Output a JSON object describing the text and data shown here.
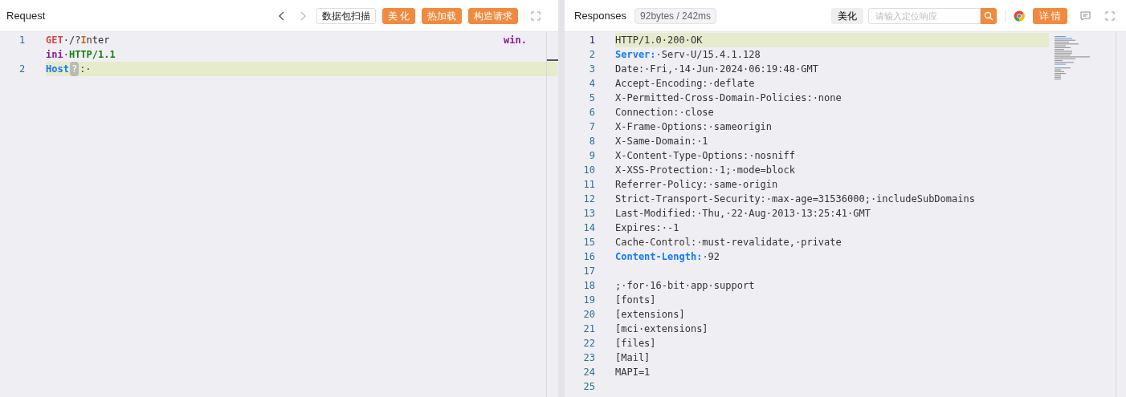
{
  "request": {
    "title": "Request",
    "actions": [
      {
        "label": "数据包扫描",
        "kind": "outline"
      },
      {
        "label": "美 化",
        "kind": "primary"
      },
      {
        "label": "热加载",
        "kind": "primary"
      },
      {
        "label": "构造请求",
        "kind": "primary"
      }
    ],
    "lines": [
      {
        "number": "1",
        "highlighted": false,
        "rows": [
          {
            "tokens": [
              {
                "text": "GET",
                "kind": "method"
              },
              {
                "text": "·/?",
                "kind": "plain"
              },
              {
                "text": "I",
                "kind": "param"
              },
              {
                "text": "nter",
                "kind": "plain"
              }
            ],
            "trailing": [
              {
                "text": "win.",
                "kind": "keyword"
              }
            ]
          },
          {
            "tokens": [
              {
                "text": "ini",
                "kind": "keyword"
              },
              {
                "text": "·",
                "kind": "plain"
              },
              {
                "text": "HTTP/1.1",
                "kind": "version"
              }
            ]
          }
        ]
      },
      {
        "number": "2",
        "highlighted": true,
        "rows": [
          {
            "tokens": [
              {
                "text": "Host",
                "kind": "header-key"
              },
              {
                "text": "?",
                "kind": "hint"
              },
              {
                "text": ":·",
                "kind": "plain"
              }
            ]
          }
        ]
      }
    ]
  },
  "response": {
    "title": "Responses",
    "stats": "92bytes / 242ms",
    "beautify": "美化",
    "search": {
      "placeholder": "请输入定位响应"
    },
    "details": "详 情",
    "lines": [
      {
        "number": "1",
        "highlighted": true,
        "tokens": [
          {
            "text": "HTTP/1.0·200·OK",
            "kind": "plain"
          }
        ]
      },
      {
        "number": "2",
        "highlighted": false,
        "tokens": [
          {
            "text": "Server:",
            "kind": "header-key"
          },
          {
            "text": "·Serv-U/15.4.1.128",
            "kind": "plain"
          }
        ]
      },
      {
        "number": "3",
        "highlighted": false,
        "tokens": [
          {
            "text": "Date:·Fri,·14·Jun·2024·06:19:48·GMT",
            "kind": "plain"
          }
        ]
      },
      {
        "number": "4",
        "highlighted": false,
        "tokens": [
          {
            "text": "Accept-Encoding:·deflate",
            "kind": "plain"
          }
        ]
      },
      {
        "number": "5",
        "highlighted": false,
        "tokens": [
          {
            "text": "X-Permitted-Cross-Domain-Policies:·none",
            "kind": "plain"
          }
        ]
      },
      {
        "number": "6",
        "highlighted": false,
        "tokens": [
          {
            "text": "Connection:·close",
            "kind": "plain"
          }
        ]
      },
      {
        "number": "7",
        "highlighted": false,
        "tokens": [
          {
            "text": "X-Frame-Options:·sameorigin",
            "kind": "plain"
          }
        ]
      },
      {
        "number": "8",
        "highlighted": false,
        "tokens": [
          {
            "text": "X-Same-Domain:·1",
            "kind": "plain"
          }
        ]
      },
      {
        "number": "9",
        "highlighted": false,
        "tokens": [
          {
            "text": "X-Content-Type-Options:·nosniff",
            "kind": "plain"
          }
        ]
      },
      {
        "number": "10",
        "highlighted": false,
        "tokens": [
          {
            "text": "X-XSS-Protection:·1;·mode=block",
            "kind": "plain"
          }
        ]
      },
      {
        "number": "11",
        "highlighted": false,
        "tokens": [
          {
            "text": "Referrer-Policy:·same-origin",
            "kind": "plain"
          }
        ]
      },
      {
        "number": "12",
        "highlighted": false,
        "tokens": [
          {
            "text": "Strict-Transport-Security:·max-age=31536000;·includeSubDomains",
            "kind": "plain"
          }
        ]
      },
      {
        "number": "13",
        "highlighted": false,
        "tokens": [
          {
            "text": "Last-Modified:·Thu,·22·Aug·2013·13:25:41·GMT",
            "kind": "plain"
          }
        ]
      },
      {
        "number": "14",
        "highlighted": false,
        "tokens": [
          {
            "text": "Expires:·-1",
            "kind": "plain"
          }
        ]
      },
      {
        "number": "15",
        "highlighted": false,
        "tokens": [
          {
            "text": "Cache-Control:·must-revalidate,·private",
            "kind": "plain"
          }
        ]
      },
      {
        "number": "16",
        "highlighted": false,
        "tokens": [
          {
            "text": "Content-Length:",
            "kind": "header-key"
          },
          {
            "text": "·92",
            "kind": "plain"
          }
        ]
      },
      {
        "number": "17",
        "highlighted": false
      },
      {
        "number": "18",
        "highlighted": false,
        "tokens": [
          {
            "text": ";·for·16-bit·app·support",
            "kind": "plain"
          }
        ]
      },
      {
        "number": "19",
        "highlighted": false,
        "tokens": [
          {
            "text": "[fonts]",
            "kind": "plain"
          }
        ]
      },
      {
        "number": "20",
        "highlighted": false,
        "tokens": [
          {
            "text": "[extensions]",
            "kind": "plain"
          }
        ]
      },
      {
        "number": "21",
        "highlighted": false,
        "tokens": [
          {
            "text": "[mci·extensions]",
            "kind": "plain"
          }
        ]
      },
      {
        "number": "22",
        "highlighted": false,
        "tokens": [
          {
            "text": "[files]",
            "kind": "plain"
          }
        ]
      },
      {
        "number": "23",
        "highlighted": false,
        "tokens": [
          {
            "text": "[Mail]",
            "kind": "plain"
          }
        ]
      },
      {
        "number": "24",
        "highlighted": false,
        "tokens": [
          {
            "text": "MAPI=1",
            "kind": "plain"
          }
        ]
      },
      {
        "number": "25",
        "highlighted": false
      }
    ]
  }
}
